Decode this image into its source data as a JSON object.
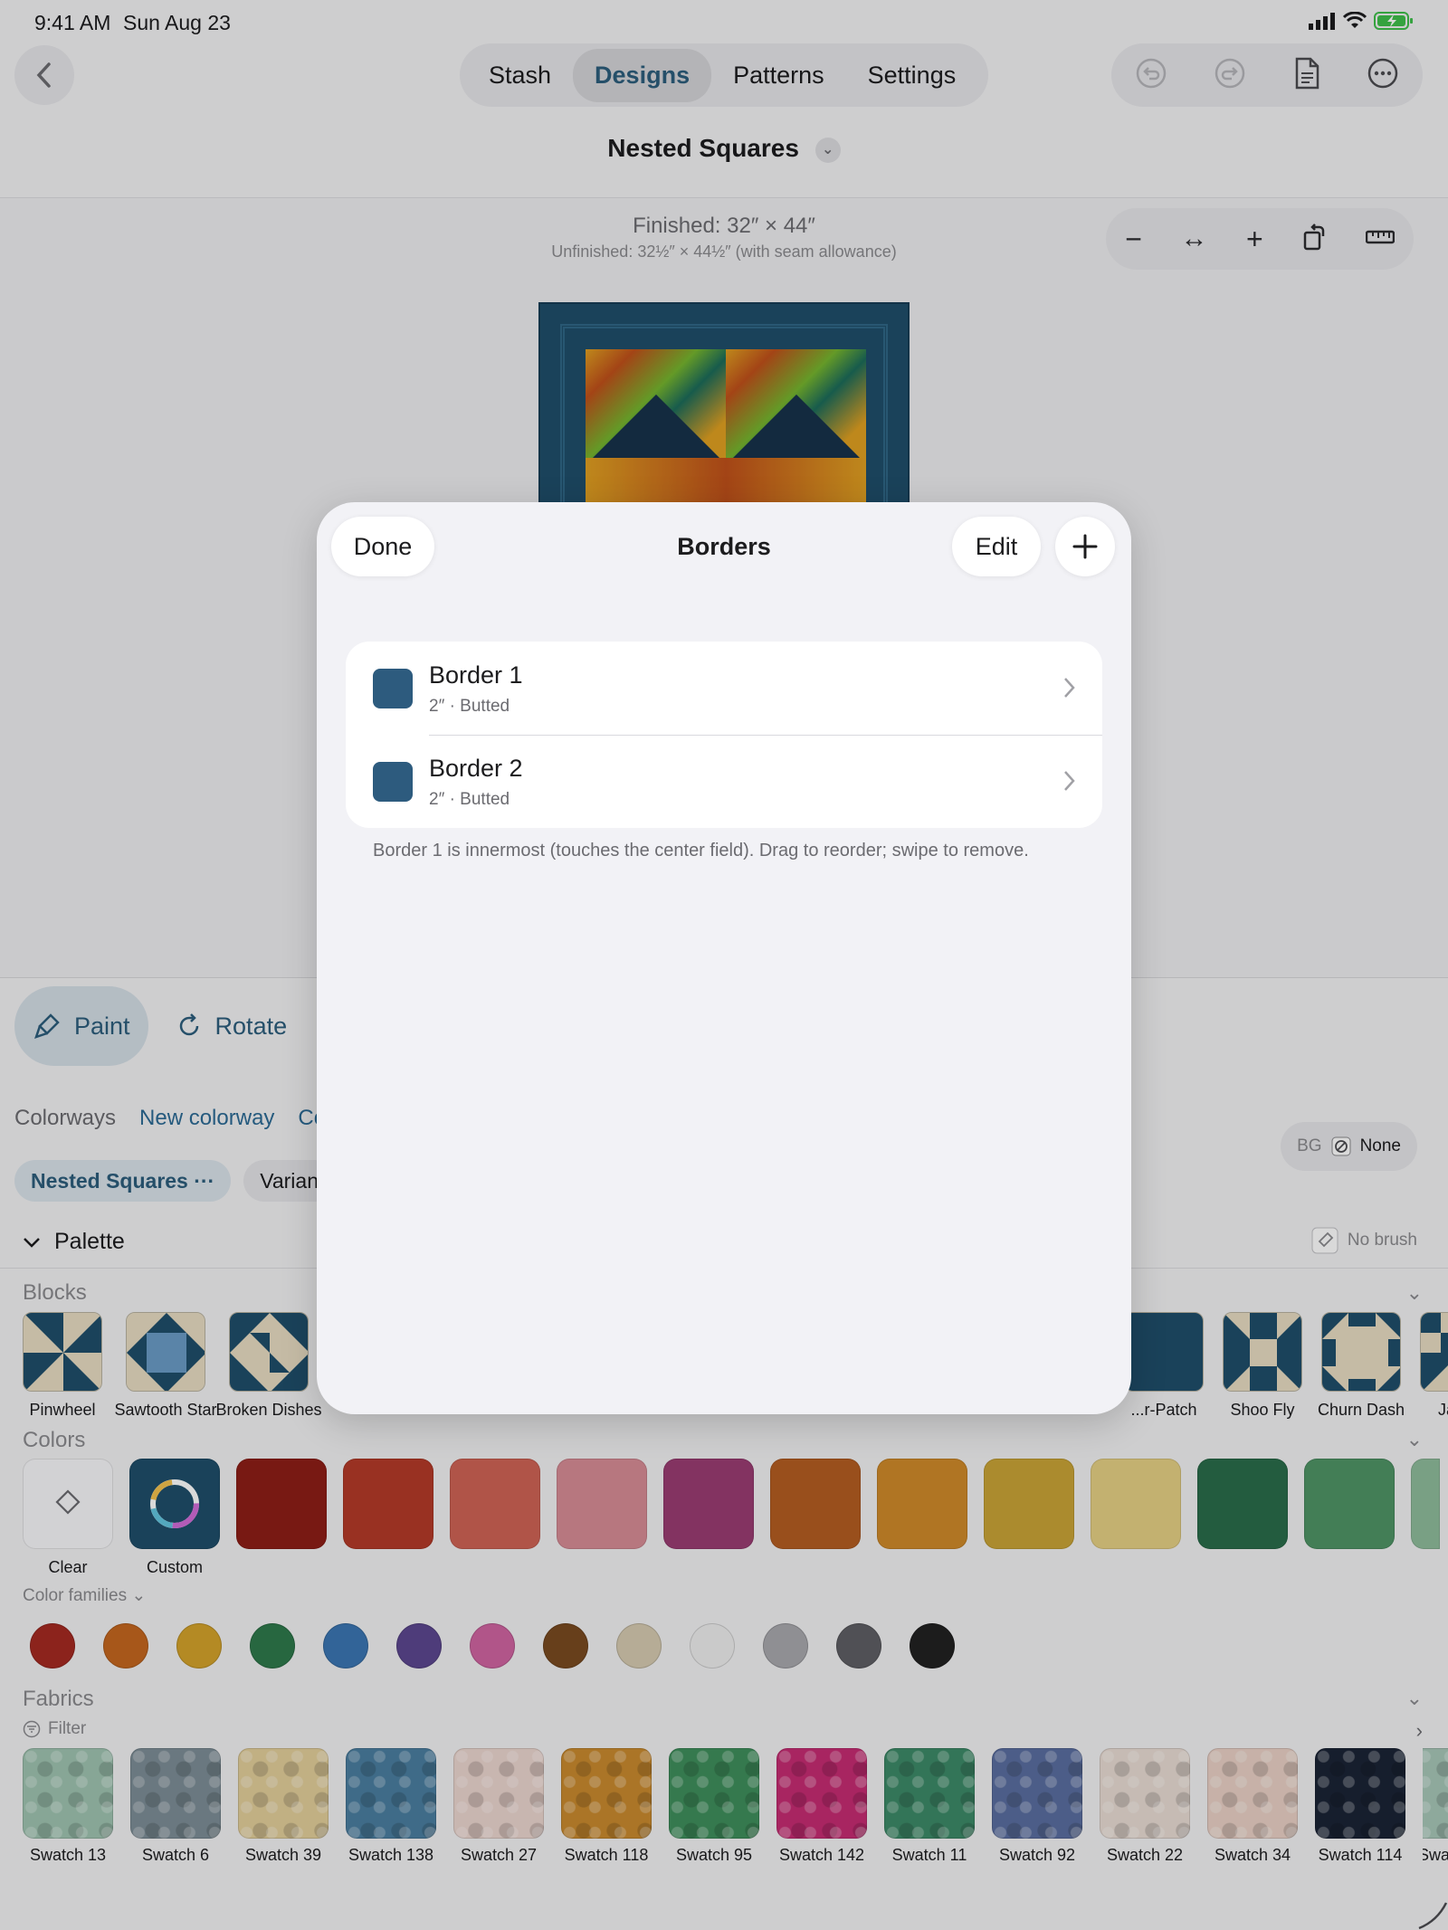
{
  "status": {
    "time": "9:41 AM",
    "date": "Sun Aug 23"
  },
  "nav": {
    "tabs": [
      {
        "label": "Stash",
        "active": false
      },
      {
        "label": "Designs",
        "active": true
      },
      {
        "label": "Patterns",
        "active": false
      },
      {
        "label": "Settings",
        "active": false
      }
    ],
    "design_title": "Nested Squares"
  },
  "canvas": {
    "finished": "Finished: 32″ × 44″",
    "unfinished": "Unfinished: 32½″ × 44½″ (with seam allowance)"
  },
  "modes": {
    "paint": "Paint",
    "rotate": "Rotate"
  },
  "colorways": {
    "items": [
      "Colorways",
      "New colorway",
      "Co"
    ],
    "chips": [
      "Nested Squares ···",
      "Varian"
    ],
    "bg_label": "BG",
    "bg_value": "None"
  },
  "palette": {
    "title": "Palette",
    "no_brush": "No brush",
    "blocks_label": "Blocks",
    "blocks": [
      "Pinwheel",
      "Sawtooth Star",
      "Broken Dishes",
      "...r-Patch",
      "Shoo Fly",
      "Churn Dash",
      "Jacob"
    ],
    "colors_label": "Colors",
    "clear_label": "Clear",
    "custom_label": "Custom",
    "colors": [
      "#8e1e17",
      "#b43a28",
      "#cf6355",
      "#d78c96",
      "#9a3d73",
      "#b45d22",
      "#cf8a2a",
      "#c9a437",
      "#e6d084",
      "#2a6d4a",
      "#4f9466",
      "#8fbd9c"
    ],
    "families_label": "Color families",
    "families": [
      "#a52a22",
      "#c5671f",
      "#d4a32b",
      "#2e7a4c",
      "#3b76b3",
      "#5c4790",
      "#d064a2",
      "#7a4a20",
      "#d6cbb1",
      "#eeeeee",
      "#a8a8ad",
      "#5f5f64",
      "#222222"
    ],
    "fabrics_label": "Fabrics",
    "filter_label": "Filter",
    "fabrics": [
      {
        "name": "Swatch 13",
        "color": "#9fc4b1"
      },
      {
        "name": "Swatch 6",
        "color": "#7d8e97"
      },
      {
        "name": "Swatch 39",
        "color": "#e3cf9b"
      },
      {
        "name": "Swatch 138",
        "color": "#4a7ea0"
      },
      {
        "name": "Swatch 27",
        "color": "#ecd6cf"
      },
      {
        "name": "Swatch 118",
        "color": "#c98a2e"
      },
      {
        "name": "Swatch 95",
        "color": "#3f8f5c"
      },
      {
        "name": "Swatch 142",
        "color": "#c62c73"
      },
      {
        "name": "Swatch 11",
        "color": "#3d8a68"
      },
      {
        "name": "Swatch 92",
        "color": "#5a6ea0"
      },
      {
        "name": "Swatch 22",
        "color": "#e9dcd4"
      },
      {
        "name": "Swatch 34",
        "color": "#ead1c6"
      },
      {
        "name": "Swatch 114",
        "color": "#1b2436"
      },
      {
        "name": "Swat",
        "color": "#a7c7b8"
      }
    ]
  },
  "modal": {
    "title": "Borders",
    "done": "Done",
    "edit": "Edit",
    "add_symbol": "+",
    "borders": [
      {
        "name": "Border 1",
        "detail": "2″ · Butted",
        "color": "#2d5b7e"
      },
      {
        "name": "Border 2",
        "detail": "2″ · Butted",
        "color": "#2d5b7e"
      }
    ],
    "footnote": "Border 1 is innermost (touches the center field). Drag to reorder; swipe to remove."
  }
}
